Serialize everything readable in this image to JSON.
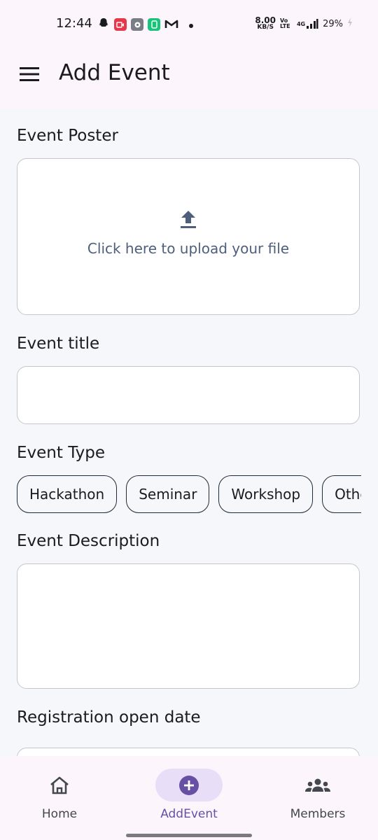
{
  "status_bar": {
    "time": "12:44",
    "speed_value": "8.00",
    "speed_unit": "KB/S",
    "volte": "Vo LTE",
    "network": "4G",
    "battery": "29%",
    "notification_icons": [
      "snapchat-icon",
      "screen-record-icon",
      "settings-app-icon",
      "app-icon",
      "gmail-icon",
      "dot-icon"
    ]
  },
  "app_bar": {
    "title": "Add Event"
  },
  "form": {
    "poster_label": "Event Poster",
    "upload_text": "Click here to upload your file",
    "title_label": "Event title",
    "title_value": "",
    "type_label": "Event Type",
    "event_types": [
      "Hackathon",
      "Seminar",
      "Workshop",
      "Others"
    ],
    "description_label": "Event Description",
    "description_value": "",
    "registration_label": "Registration open date"
  },
  "bottom_nav": {
    "items": [
      {
        "label": "Home",
        "icon": "home-icon",
        "selected": false
      },
      {
        "label": "AddEvent",
        "icon": "add-circle-icon",
        "selected": true
      },
      {
        "label": "Members",
        "icon": "group-icon",
        "selected": false
      }
    ]
  },
  "colors": {
    "accent": "#6750a4",
    "accent_container": "#e8def8",
    "upload_icon": "#4d5f7c",
    "chip_border": "#1d2b3a"
  }
}
